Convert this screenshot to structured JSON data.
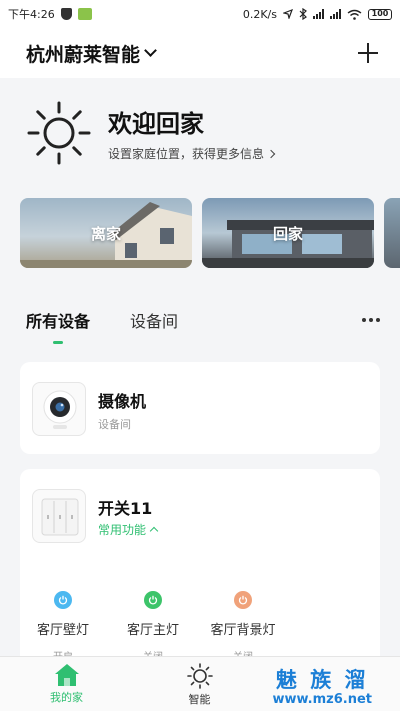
{
  "status_bar": {
    "time": "下午4:26",
    "speed": "0.2K/s",
    "battery": "100"
  },
  "header": {
    "home_name": "杭州蔚莱智能"
  },
  "welcome": {
    "title": "欢迎回家",
    "subtitle": "设置家庭位置，获得更多信息"
  },
  "scenes": [
    {
      "label": "离家"
    },
    {
      "label": "回家"
    }
  ],
  "tabs": [
    {
      "label": "所有设备",
      "active": true
    },
    {
      "label": "设备间",
      "active": false
    }
  ],
  "devices": [
    {
      "name": "摄像机",
      "room": "设备间"
    },
    {
      "name": "开关11",
      "common_label": "常用功能",
      "lights": [
        {
          "label": "客厅壁灯",
          "state": "开启",
          "color": "#4cb8f0"
        },
        {
          "label": "客厅主灯",
          "state": "关闭",
          "color": "#3dc46a"
        },
        {
          "label": "客厅背景灯",
          "state": "关闭",
          "color": "#f0a27a"
        }
      ]
    }
  ],
  "bottom_nav": [
    {
      "label": "我的家",
      "active": true
    },
    {
      "label": "智能",
      "active": false
    }
  ],
  "watermark": {
    "title": "魅 族 溜",
    "url": "www.mz6.net"
  },
  "colors": {
    "accent": "#2fbf71"
  }
}
